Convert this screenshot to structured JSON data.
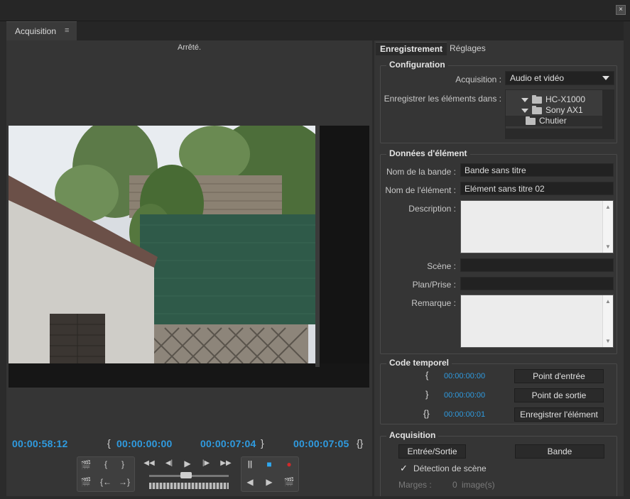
{
  "window": {
    "close_glyph": "×"
  },
  "panel_tab": {
    "label": "Acquisition",
    "menu_icon": "≡"
  },
  "monitor": {
    "status": "Arrêté.",
    "timecodes": {
      "current": "00:00:58:12",
      "in_point": "00:00:00:00",
      "out_point": "00:00:07:04",
      "duration": "00:00:07:05"
    },
    "marks": {
      "in": "{",
      "out": "}",
      "duration": "{}"
    },
    "controls": {
      "box1": [
        "🎬",
        "{",
        "}",
        "🎬",
        "{←",
        "→}"
      ],
      "transport": [
        "◀◀",
        "◀|",
        "▶",
        "|▶",
        "▶▶"
      ],
      "box3": [
        "||",
        "■",
        "●",
        "◀",
        "▶",
        "🎬"
      ]
    }
  },
  "right": {
    "tabs": {
      "record": "Enregistrement",
      "settings": "Réglages"
    },
    "configuration": {
      "title": "Configuration",
      "acquisition_label": "Acquisition :",
      "acquisition_value": "Audio et vidéo",
      "save_label": "Enregistrer les éléments dans :",
      "tree": [
        {
          "name": "HC-X1000",
          "expanded": true,
          "indent": 1
        },
        {
          "name": "Sony AX1",
          "expanded": true,
          "indent": 1
        },
        {
          "name": "Chutier",
          "expanded": false,
          "indent": 2
        }
      ]
    },
    "clip_data": {
      "title": "Données d'élément",
      "tape_label": "Nom de la bande :",
      "tape_value": "Bande sans titre",
      "clip_label": "Nom de l'élément :",
      "clip_value": "Elément sans titre 02",
      "description_label": "Description :",
      "scene_label": "Scène :",
      "shot_label": "Plan/Prise :",
      "note_label": "Remarque :"
    },
    "timecode": {
      "title": "Code temporel",
      "in_value": "00:00:00:00",
      "out_value": "00:00:00:00",
      "dur_value": "00:00:00:01",
      "set_in": "Point d'entrée",
      "set_out": "Point de sortie",
      "log_clip": "Enregistrer l'élément"
    },
    "acquisition": {
      "title": "Acquisition",
      "in_out_button": "Entrée/Sortie",
      "tape_button": "Bande",
      "scene_detect_label": "Détection de scène",
      "scene_detect_checked": true,
      "check_glyph": "✓",
      "margins_label": "Marges :",
      "margins_value": "0",
      "margins_unit": "image(s)"
    }
  }
}
